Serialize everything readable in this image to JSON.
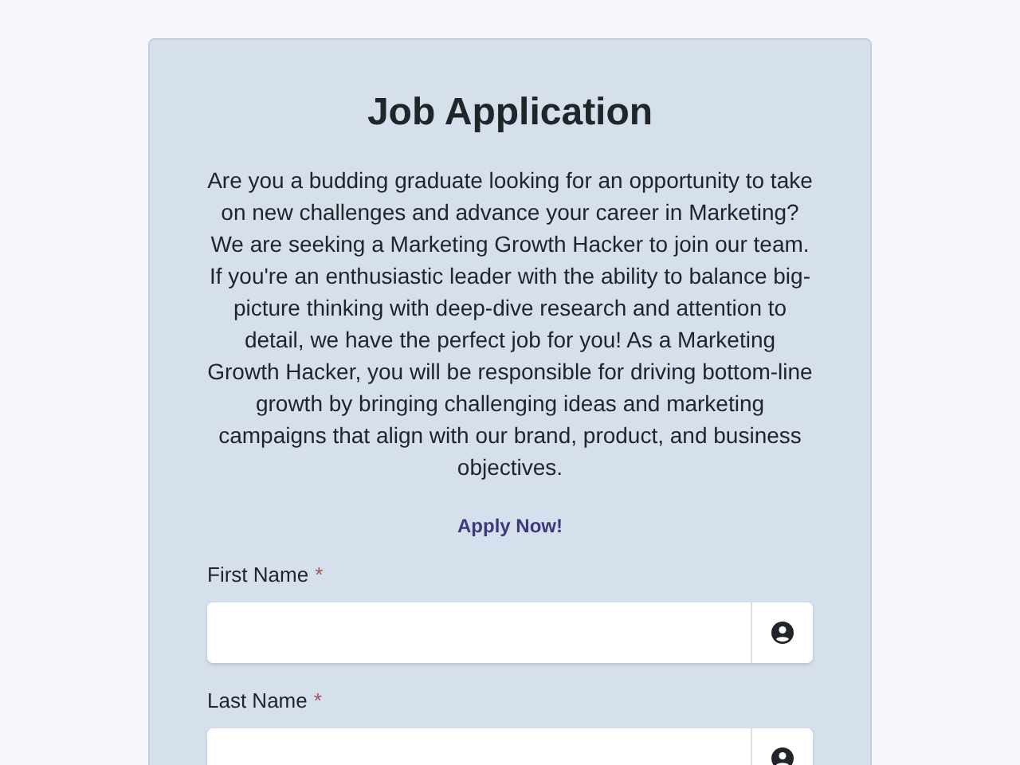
{
  "form": {
    "title": "Job Application",
    "description": "Are you a budding graduate looking for an opportunity to take on new challenges and advance your career in Marketing? We are seeking a Marketing Growth Hacker to join our team. If you're an enthusiastic leader with the ability to balance big-picture thinking with deep-dive research and attention to detail, we have the perfect job for you! As a Marketing Growth Hacker, you will be responsible for driving bottom-line growth by bringing challenging ideas and marketing campaigns that align with our brand, product, and business objectives.",
    "call_to_action": "Apply Now!",
    "fields": [
      {
        "label": "First Name",
        "required_mark": "*"
      },
      {
        "label": "Last Name",
        "required_mark": "*"
      }
    ]
  }
}
